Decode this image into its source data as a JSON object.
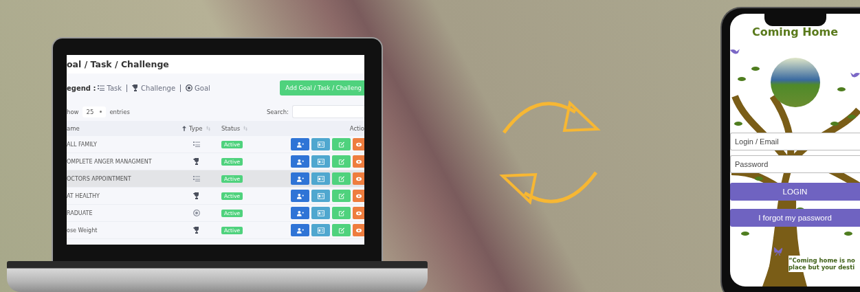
{
  "laptop_screen": {
    "title": "oal / Task / Challenge",
    "legend_label": "egend :",
    "legend": [
      {
        "kind": "task",
        "label": "Task"
      },
      {
        "kind": "challenge",
        "label": "Challenge"
      },
      {
        "kind": "goal",
        "label": "Goal"
      }
    ],
    "add_button": "Add Goal / Task / Challeng",
    "show_label": "how",
    "page_size": "25",
    "entries_label": "entries",
    "search_label": "Search:",
    "columns": [
      {
        "label": "ame",
        "sortable": true,
        "sorted": true
      },
      {
        "label": "Type",
        "sortable": true,
        "sorted": false
      },
      {
        "label": "Status",
        "sortable": true,
        "sorted": false
      },
      {
        "label": "Actio",
        "sortable": false
      }
    ],
    "rows": [
      {
        "name": "ALL FAMILY",
        "kind": "task",
        "status": "Active",
        "highlighted": false
      },
      {
        "name": "OMPLETE ANGER MANAGMENT",
        "kind": "challenge",
        "status": "Active",
        "highlighted": false
      },
      {
        "name": "OCTORS APPOINTMENT",
        "kind": "task",
        "status": "Active",
        "highlighted": true
      },
      {
        "name": "AT HEALTHY",
        "kind": "challenge",
        "status": "Active",
        "highlighted": false
      },
      {
        "name": "RADUATE",
        "kind": "goal",
        "status": "Active",
        "highlighted": false
      },
      {
        "name": "ose Weight",
        "kind": "challenge",
        "status": "Active",
        "highlighted": false
      }
    ]
  },
  "phone_screen": {
    "title": "Coming Home",
    "login_placeholder": "Login / Email",
    "password_placeholder": "Password",
    "login_button": "LOGIN",
    "forgot_button": "I forgot my password",
    "quote": [
      "“Coming home is no",
      "place but your desti"
    ]
  }
}
